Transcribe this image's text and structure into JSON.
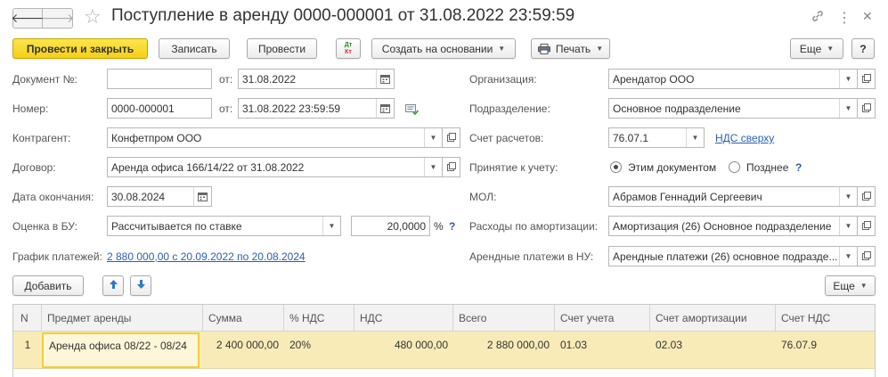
{
  "window": {
    "title": "Поступление в аренду 0000-000001 от 31.08.2022 23:59:59",
    "back_icon": "arrow-left",
    "forward_icon": "arrow-right",
    "star_icon": "star-outline"
  },
  "toolbar": {
    "post_close": "Провести и закрыть",
    "save": "Записать",
    "post": "Провести",
    "dt_kt_top": "Дт",
    "dt_kt_bottom": "Кт",
    "create_based": "Создать на основании",
    "print": "Печать",
    "more": "Еще",
    "help": "?"
  },
  "left": {
    "doc_no_label": "Документ №:",
    "doc_no_value": "",
    "doc_date_label": "от:",
    "doc_date_value": "31.08.2022",
    "number_label": "Номер:",
    "number_value": "0000-000001",
    "number_date_label": "от:",
    "number_date_value": "31.08.2022 23:59:59",
    "counterparty_label": "Контрагент:",
    "counterparty_value": "Конфетпром ООО",
    "contract_label": "Договор:",
    "contract_value": "Аренда офиса 166/14/22 от 31.08.2022",
    "end_date_label": "Дата окончания:",
    "end_date_value": "30.08.2024",
    "valuation_label": "Оценка в БУ:",
    "valuation_value": "Рассчитывается по ставке",
    "rate_value": "20,0000",
    "rate_unit": "%",
    "rate_help": "?",
    "schedule_label": "График платежей:",
    "schedule_link": "2 880 000,00 с 20.09.2022 по 20.08.2024"
  },
  "right": {
    "org_label": "Организация:",
    "org_value": "Арендатор ООО",
    "dept_label": "Подразделение:",
    "dept_value": "Основное подразделение",
    "account_label": "Счет расчетов:",
    "account_value": "76.07.1",
    "vat_link": "НДС сверху",
    "acceptance_label": "Принятие к учету:",
    "acceptance_opt1": "Этим документом",
    "acceptance_opt2": "Позднее",
    "acceptance_selected": "Этим документом",
    "acceptance_help": "?",
    "mol_label": "МОЛ:",
    "mol_value": "Абрамов Геннадий Сергеевич",
    "depr_label": "Расходы по амортизации:",
    "depr_value": "Амортизация (26) Основное подразделение",
    "rent_label": "Арендные платежи в НУ:",
    "rent_value": "Арендные платежи (26) основное подразде..."
  },
  "table_toolbar": {
    "add": "Добавить",
    "more": "Еще"
  },
  "table": {
    "columns": [
      "N",
      "Предмет аренды",
      "Сумма",
      "% НДС",
      "НДС",
      "Всего",
      "Счет учета",
      "Счет амортизации",
      "Счет НДС"
    ],
    "rows": [
      {
        "n": "1",
        "item": "Аренда офиса 08/22 - 08/24",
        "sum": "2 400 000,00",
        "vat_rate": "20%",
        "vat": "480 000,00",
        "total": "2 880 000,00",
        "account": "01.03",
        "depr_account": "02.03",
        "vat_account": "76.07.9"
      }
    ]
  },
  "colors": {
    "primary_button": "#f5cf16",
    "link": "#2a5fb0",
    "row_highlight": "#f9ebb8"
  }
}
